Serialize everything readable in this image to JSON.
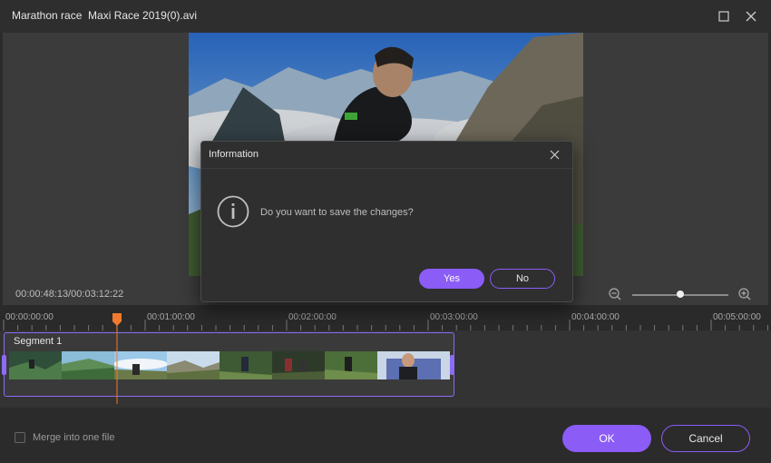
{
  "window": {
    "title": "Marathon race  Maxi Race 2019(0).avi",
    "maximize_icon": "maximize-icon",
    "close_icon": "close-icon"
  },
  "player": {
    "timecode": "00:00:48:13/00:03:12:22",
    "zoom_level": 0.5
  },
  "timeline": {
    "ruler_labels": [
      "00:00:00:00",
      "00:01:00:00",
      "00:02:00:00",
      "00:03:00:00",
      "00:04:00:00",
      "00:05:00:00"
    ],
    "segment_label": "Segment 1",
    "playhead_time": "00:00:48:13"
  },
  "footer": {
    "merge_label": "Merge into one file",
    "merge_checked": false,
    "ok_label": "OK",
    "cancel_label": "Cancel"
  },
  "dialog": {
    "title": "Information",
    "message": "Do you want to save the changes?",
    "yes_label": "Yes",
    "no_label": "No",
    "icon": "info-icon"
  },
  "colors": {
    "accent": "#8b5cf6",
    "playhead": "#f07a2e",
    "background": "#2b2b2b"
  }
}
